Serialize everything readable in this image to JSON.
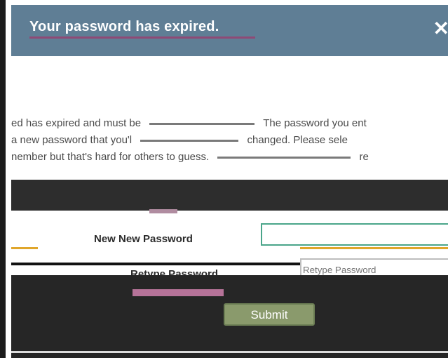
{
  "dialog": {
    "title": "Your password has expired.",
    "close_icon": "close-icon"
  },
  "message": {
    "line1_left": "ed has expired and must be",
    "line1_right": "The password you ent",
    "line2_left": "a new password that you'l",
    "line2_right": "changed. Please sele",
    "line3_left": "nember but that's hard for others to guess.",
    "line3_right": "re"
  },
  "form": {
    "new_password_label": "New New Password",
    "new_password_value": "",
    "retype_password_label": "Retype Password",
    "retype_password_value": "Retype Password"
  },
  "actions": {
    "submit_label": "Submit"
  },
  "colors": {
    "header": "#5f7e95",
    "accent_green": "#4aa58a",
    "accent_orange": "#e0a62b",
    "accent_pink": "#b67399",
    "button": "#8a9a6c"
  }
}
